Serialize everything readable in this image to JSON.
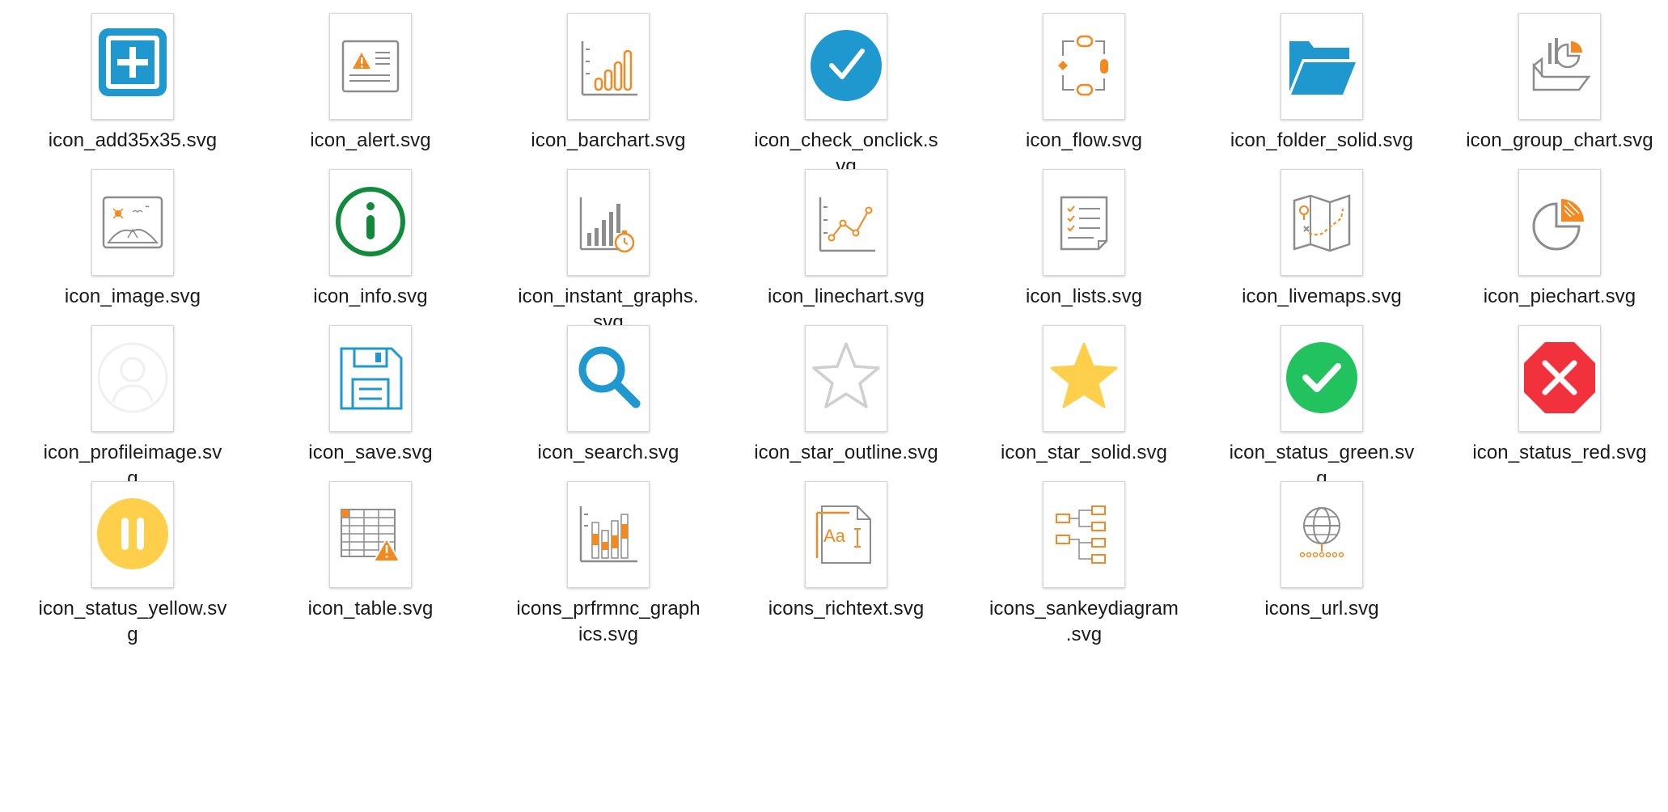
{
  "files": [
    {
      "name": "icon_add35x35.svg",
      "icon": "add-icon"
    },
    {
      "name": "icon_alert.svg",
      "icon": "alert-icon"
    },
    {
      "name": "icon_barchart.svg",
      "icon": "barchart-icon"
    },
    {
      "name": "icon_check_onclick.svg",
      "icon": "check-icon"
    },
    {
      "name": "icon_flow.svg",
      "icon": "flow-icon"
    },
    {
      "name": "icon_folder_solid.svg",
      "icon": "folder-icon"
    },
    {
      "name": "icon_group_chart.svg",
      "icon": "group-chart-icon"
    },
    {
      "name": "icon_image.svg",
      "icon": "image-icon"
    },
    {
      "name": "icon_info.svg",
      "icon": "info-icon"
    },
    {
      "name": "icon_instant_graphs.svg",
      "icon": "instant-graphs-icon"
    },
    {
      "name": "icon_linechart.svg",
      "icon": "linechart-icon"
    },
    {
      "name": "icon_lists.svg",
      "icon": "lists-icon"
    },
    {
      "name": "icon_livemaps.svg",
      "icon": "livemaps-icon"
    },
    {
      "name": "icon_piechart.svg",
      "icon": "piechart-icon"
    },
    {
      "name": "icon_profileimage.svg",
      "icon": "profile-image-icon"
    },
    {
      "name": "icon_save.svg",
      "icon": "save-icon"
    },
    {
      "name": "icon_search.svg",
      "icon": "search-icon"
    },
    {
      "name": "icon_star_outline.svg",
      "icon": "star-outline-icon"
    },
    {
      "name": "icon_star_solid.svg",
      "icon": "star-solid-icon"
    },
    {
      "name": "icon_status_green.svg",
      "icon": "status-green-icon"
    },
    {
      "name": "icon_status_red.svg",
      "icon": "status-red-icon"
    },
    {
      "name": "icon_status_yellow.svg",
      "icon": "status-yellow-icon"
    },
    {
      "name": "icon_table.svg",
      "icon": "table-icon"
    },
    {
      "name": "icons_prfrmnc_graphics.svg",
      "icon": "performance-graphics-icon"
    },
    {
      "name": "icons_richtext.svg",
      "icon": "richtext-icon"
    },
    {
      "name": "icons_sankeydiagram.svg",
      "icon": "sankey-diagram-icon"
    },
    {
      "name": "icons_url.svg",
      "icon": "url-icon"
    }
  ],
  "colors": {
    "blue": "#1f97cf",
    "orange": "#f28a21",
    "gray": "#8c8c8c",
    "green": "#22c35e",
    "dark_green": "#128a3c",
    "red": "#f1323c",
    "yellow": "#fdcf4a"
  }
}
